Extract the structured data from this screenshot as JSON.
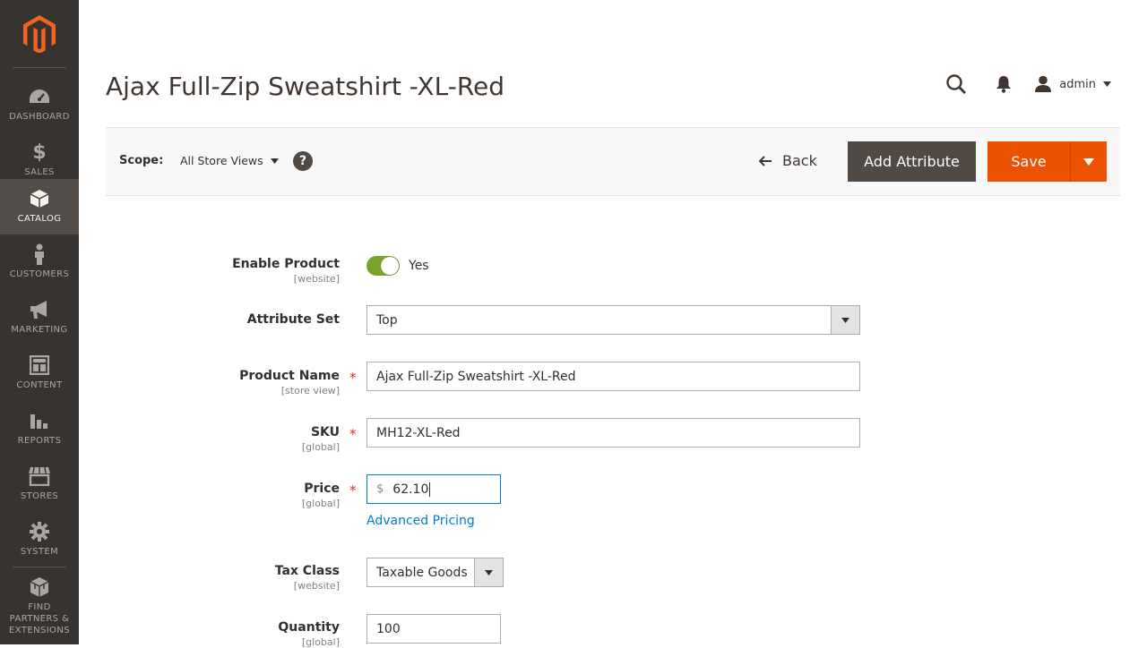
{
  "sidebar": {
    "logo_icon": "magento-logo-icon",
    "items": [
      {
        "label": "DASHBOARD",
        "icon": "speedometer-icon",
        "active": false
      },
      {
        "label": "SALES",
        "icon": "dollar-icon",
        "active": false
      },
      {
        "label": "CATALOG",
        "icon": "box-icon",
        "active": true
      },
      {
        "label": "CUSTOMERS",
        "icon": "person-icon",
        "active": false
      },
      {
        "label": "MARKETING",
        "icon": "megaphone-icon",
        "active": false
      },
      {
        "label": "CONTENT",
        "icon": "layout-icon",
        "active": false
      },
      {
        "label": "REPORTS",
        "icon": "bar-chart-icon",
        "active": false
      },
      {
        "label": "STORES",
        "icon": "storefront-icon",
        "active": false
      },
      {
        "label": "SYSTEM",
        "icon": "gear-icon",
        "active": false
      },
      {
        "label": "FIND PARTNERS & EXTENSIONS",
        "icon": "cubes-icon",
        "active": false
      }
    ]
  },
  "header": {
    "title": "Ajax Full-Zip Sweatshirt -XL-Red",
    "user": "admin"
  },
  "toolbar": {
    "scope_label": "Scope:",
    "scope_value": "All Store Views",
    "help": "?",
    "back_label": "Back",
    "add_attribute_label": "Add Attribute",
    "save_label": "Save"
  },
  "form": {
    "enable_product": {
      "label": "Enable Product",
      "scope": "[website]",
      "value": "Yes"
    },
    "attribute_set": {
      "label": "Attribute Set",
      "value": "Top"
    },
    "product_name": {
      "label": "Product Name",
      "scope": "[store view]",
      "value": "Ajax Full-Zip Sweatshirt -XL-Red"
    },
    "sku": {
      "label": "SKU",
      "scope": "[global]",
      "value": "MH12-XL-Red"
    },
    "price": {
      "label": "Price",
      "scope": "[global]",
      "currency": "$",
      "value": "62.10",
      "advanced_link": "Advanced Pricing"
    },
    "tax_class": {
      "label": "Tax Class",
      "scope": "[website]",
      "value": "Taxable Goods"
    },
    "quantity": {
      "label": "Quantity",
      "scope": "[global]",
      "value": "100"
    },
    "required_mark": "*"
  },
  "colors": {
    "sidebar_bg": "#373330",
    "sidebar_active": "#524d49",
    "accent_orange": "#eb5202",
    "link_blue": "#007bdb",
    "toggle_green": "#79a22e"
  }
}
